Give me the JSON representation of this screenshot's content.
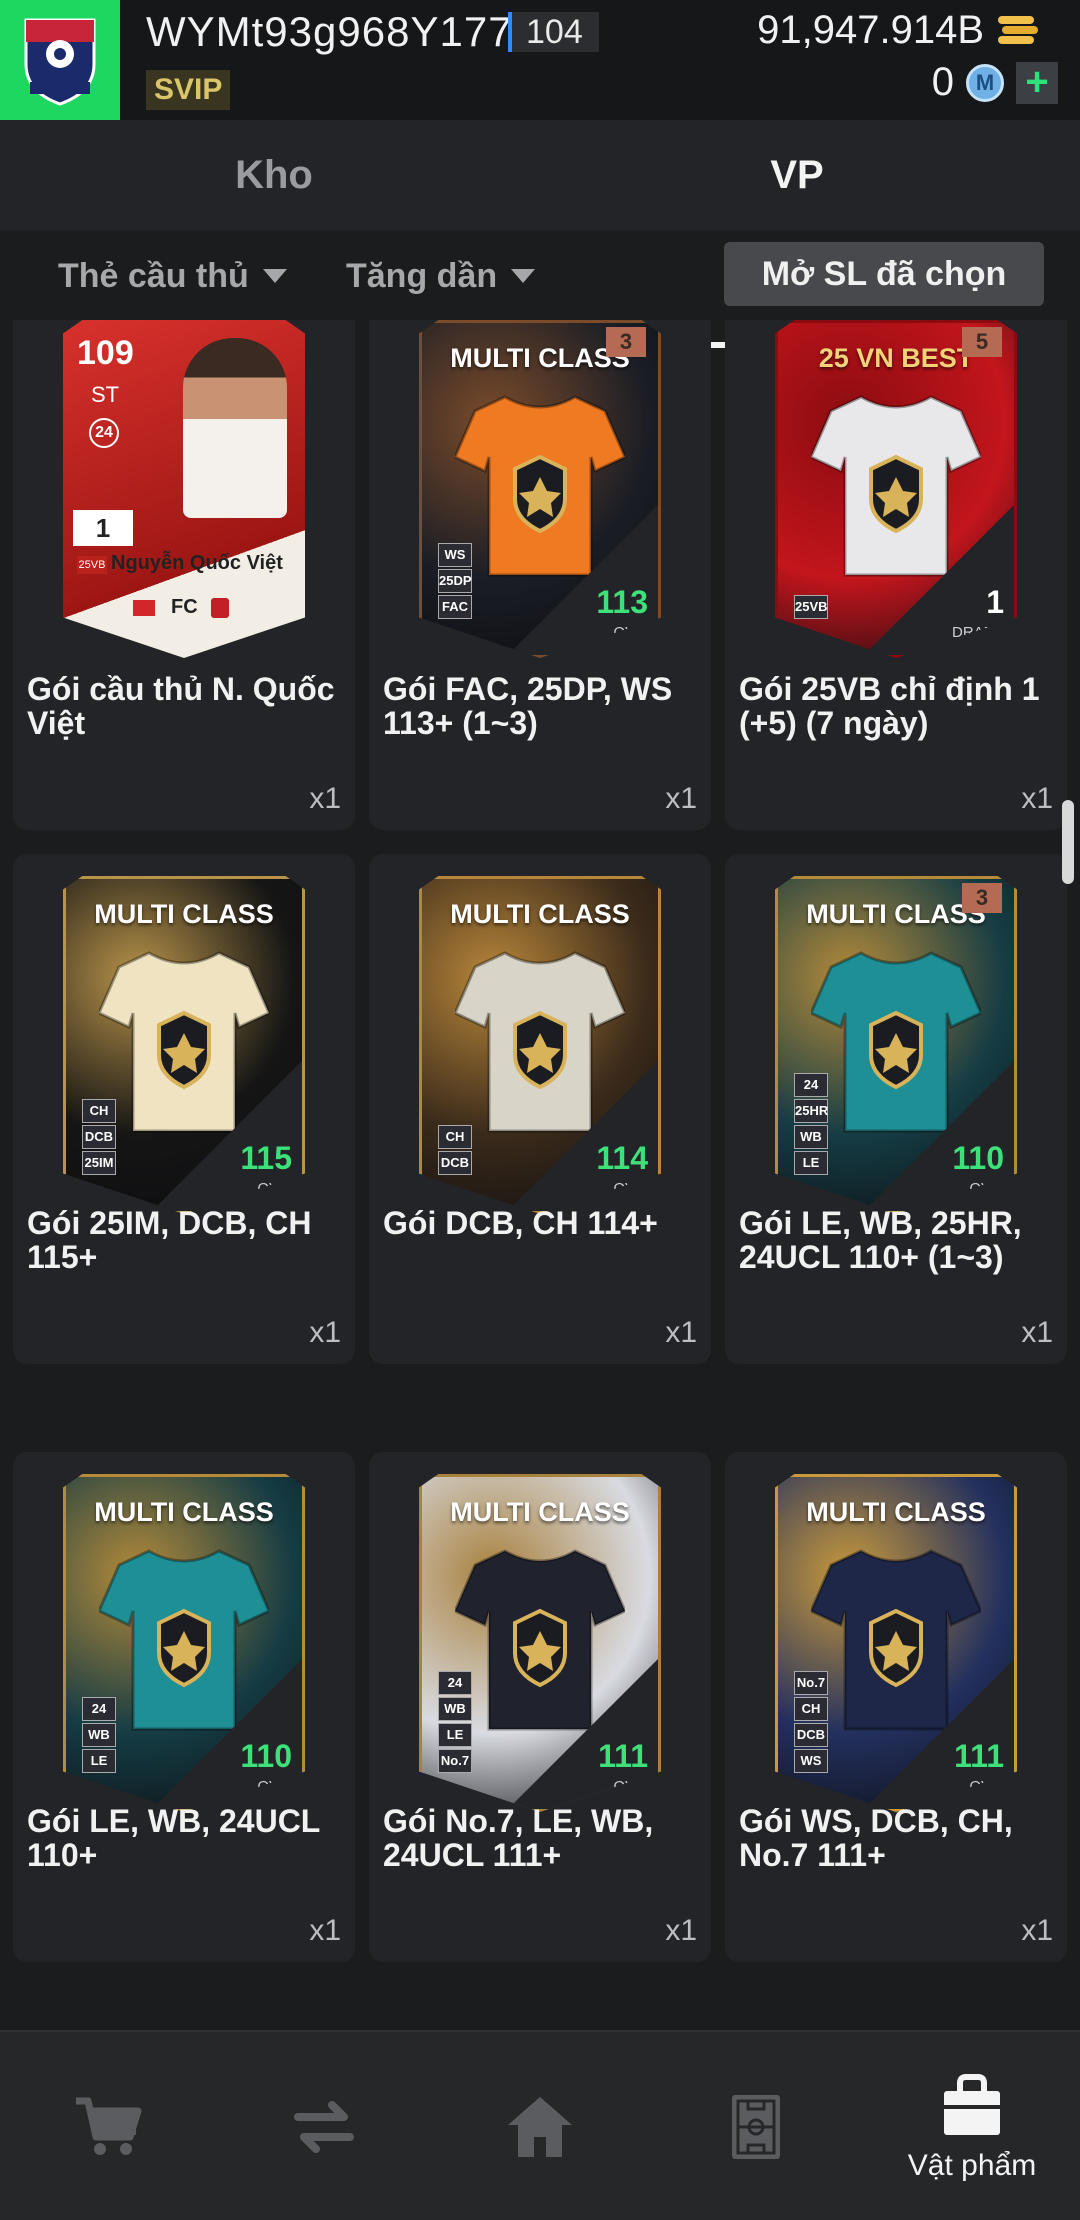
{
  "header": {
    "username": "WYMt93g968Y177",
    "level": "104",
    "vip": "SVIP",
    "coins": "91,947.914B",
    "points": "0",
    "points_icon": "M",
    "plus": "+"
  },
  "tabs": [
    {
      "label": "Kho",
      "active": false
    },
    {
      "label": "VP",
      "active": true
    }
  ],
  "filters": {
    "type": "Thẻ cầu thủ",
    "order": "Tăng dần",
    "open_selected": "Mở SL đã chọn"
  },
  "items": [
    {
      "name": "Gói cầu thủ N. Quốc Việt",
      "qty": "x1",
      "card": {
        "style": "player",
        "ovr": "109",
        "position": "ST",
        "season": "24",
        "level": "1",
        "player": "Nguyễn Quốc Việt",
        "badge": "25VB"
      }
    },
    {
      "name": "Gói FAC, 25DP, WS 113+ (1~3)",
      "qty": "x1",
      "card": {
        "style": "multi",
        "title": "MULTI CLASS",
        "count": "3",
        "tags": [
          "WS",
          "25DP",
          "FAC"
        ],
        "ovr": "113",
        "ovr_label": "OVR",
        "colors": [
          "#ef7a22",
          "#1a1d25",
          "#7b4b2a"
        ]
      }
    },
    {
      "name": "Gói 25VB chỉ định 1 (+5) (7 ngày)",
      "qty": "x1",
      "card": {
        "style": "best",
        "title": "25 VN BEST",
        "count": "5",
        "tags": [
          "25VB"
        ],
        "ovr": "1",
        "ovr_label": "DRAFT",
        "colors": [
          "#e8e8ea",
          "#c3151c",
          "#8a0c10"
        ]
      }
    },
    {
      "name": "Gói 25IM, DCB, CH 115+",
      "qty": "x1",
      "card": {
        "style": "multi",
        "title": "MULTI CLASS",
        "count": "",
        "tags": [
          "CH",
          "DCB",
          "25IM"
        ],
        "ovr": "115",
        "ovr_label": "OVR",
        "colors": [
          "#efe3c2",
          "#151515",
          "#b89349"
        ]
      }
    },
    {
      "name": "Gói DCB, CH 114+",
      "qty": "x1",
      "card": {
        "style": "multi",
        "title": "MULTI CLASS",
        "count": "",
        "tags": [
          "CH",
          "DCB"
        ],
        "ovr": "114",
        "ovr_label": "OVR",
        "colors": [
          "#d8d4c8",
          "#3a2a1a",
          "#b8863a"
        ]
      }
    },
    {
      "name": "Gói LE, WB, 25HR, 24UCL 110+ (1~3)",
      "qty": "x1",
      "card": {
        "style": "multi",
        "title": "MULTI CLASS",
        "count": "3",
        "tags": [
          "24",
          "25HR",
          "WB",
          "LE"
        ],
        "ovr": "110",
        "ovr_label": "OVR",
        "colors": [
          "#1f8f96",
          "#153c44",
          "#b58b3a"
        ]
      }
    },
    {
      "name": "Gói LE, WB, 24UCL 110+",
      "qty": "x1",
      "card": {
        "style": "multi",
        "title": "MULTI CLASS",
        "count": "",
        "tags": [
          "24",
          "WB",
          "LE"
        ],
        "ovr": "110",
        "ovr_label": "OVR",
        "colors": [
          "#1f8f96",
          "#153c44",
          "#b58b3a"
        ]
      }
    },
    {
      "name": "Gói No.7, LE, WB, 24UCL 111+",
      "qty": "x1",
      "card": {
        "style": "multi",
        "title": "MULTI CLASS",
        "count": "",
        "tags": [
          "24",
          "WB",
          "LE",
          "No.7"
        ],
        "ovr": "111",
        "ovr_label": "OVR",
        "colors": [
          "#20232e",
          "#d9dbe2",
          "#a8813d"
        ]
      }
    },
    {
      "name": "Gói WS, DCB, CH, No.7 111+",
      "qty": "x1",
      "card": {
        "style": "multi",
        "title": "MULTI CLASS",
        "count": "",
        "tags": [
          "No.7",
          "CH",
          "DCB",
          "WS"
        ],
        "ovr": "111",
        "ovr_label": "OVR",
        "colors": [
          "#1e2747",
          "#23305e",
          "#c99a3c"
        ]
      }
    }
  ],
  "nav": [
    {
      "icon": "cart-icon",
      "label": "",
      "active": false
    },
    {
      "icon": "transfer-icon",
      "label": "",
      "active": false
    },
    {
      "icon": "home-icon",
      "label": "",
      "active": false
    },
    {
      "icon": "pitch-icon",
      "label": "",
      "active": false
    },
    {
      "icon": "bag-icon",
      "label": "Vật phẩm",
      "active": true
    }
  ],
  "colors": {
    "accent_green": "#3ee07a",
    "logo_bg": "#1ed760",
    "level_bar": "#2f8cff"
  }
}
